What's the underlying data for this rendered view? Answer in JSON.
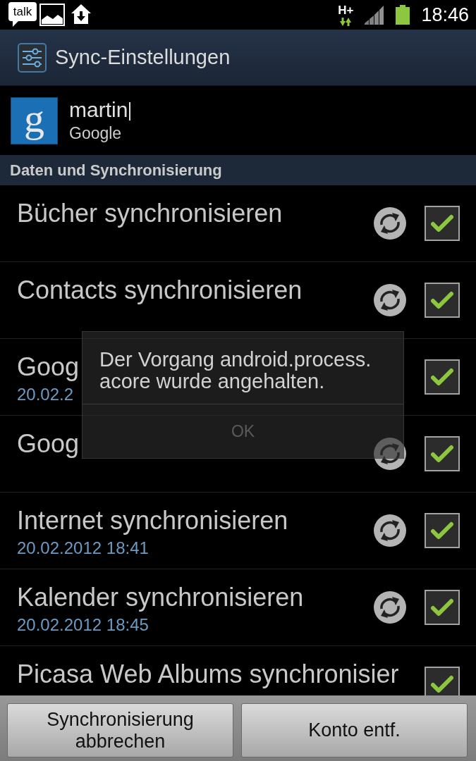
{
  "status_bar": {
    "notification_label": "talk",
    "network": "H+",
    "time": "18:46"
  },
  "title_bar": {
    "title": "Sync-Einstellungen"
  },
  "account": {
    "logo_letter": "g",
    "name": "martin",
    "type": "Google"
  },
  "section_header": "Daten und Synchronisierung",
  "sync_items": [
    {
      "title": "Bücher synchronisieren",
      "sync_icon": true,
      "checked": true
    },
    {
      "title": "Contacts synchronisieren",
      "sync_icon": true,
      "checked": true
    },
    {
      "title": "Goog",
      "date": "20.02.2",
      "sync_icon": false,
      "checked": true
    },
    {
      "title": "Goog",
      "sync_icon": true,
      "checked": true
    },
    {
      "title": "Internet synchronisieren",
      "date": "20.02.2012 18:41",
      "sync_icon": true,
      "checked": true
    },
    {
      "title": "Kalender synchronisieren",
      "date": "20.02.2012 18:45",
      "sync_icon": true,
      "checked": true
    },
    {
      "title": "Picasa Web Albums synchronisier",
      "sync_icon": false,
      "checked": true
    }
  ],
  "dialog": {
    "message": "Der Vorgang android.process.acore wurde angehalten.",
    "button": "OK"
  },
  "bottom_buttons": [
    "Synchronisierung abbrechen",
    "Konto entf."
  ]
}
